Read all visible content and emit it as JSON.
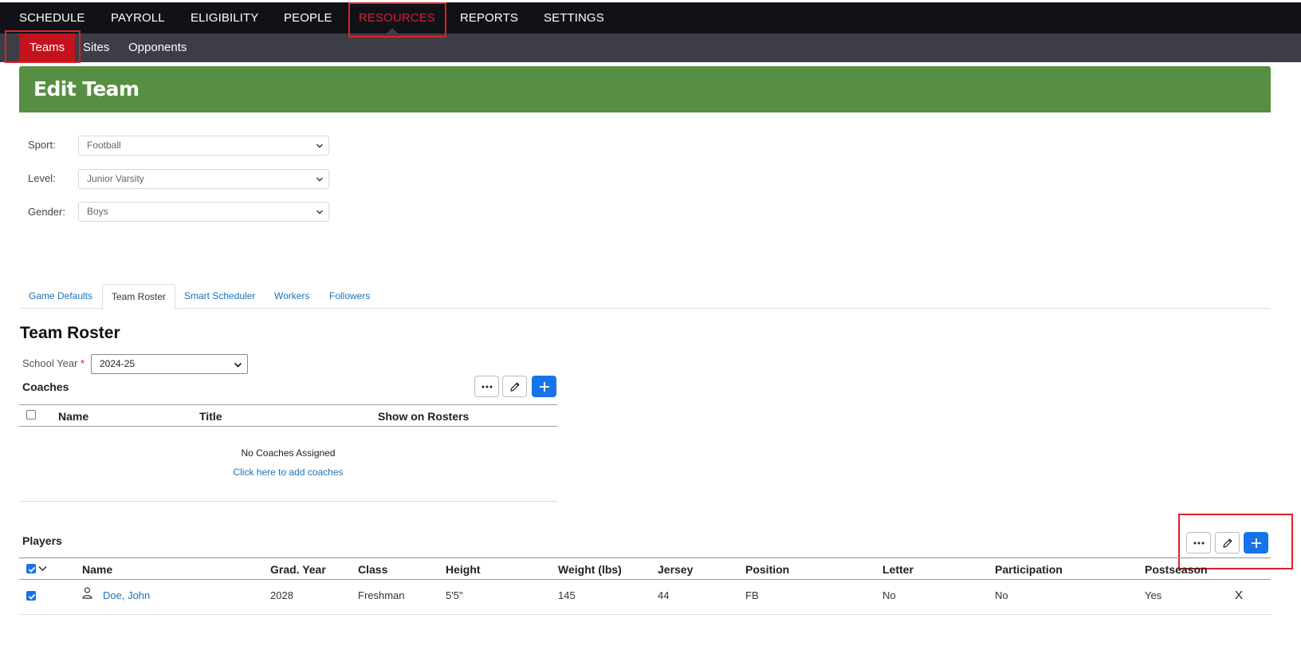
{
  "top_nav": {
    "items": [
      {
        "label": "SCHEDULE"
      },
      {
        "label": "PAYROLL"
      },
      {
        "label": "ELIGIBILITY"
      },
      {
        "label": "PEOPLE"
      },
      {
        "label": "RESOURCES"
      },
      {
        "label": "REPORTS"
      },
      {
        "label": "SETTINGS"
      }
    ],
    "active": "RESOURCES"
  },
  "sub_nav": {
    "items": [
      {
        "label": "Teams"
      },
      {
        "label": "Sites"
      },
      {
        "label": "Opponents"
      }
    ],
    "active": "Teams"
  },
  "page": {
    "title": "Edit Team"
  },
  "form": {
    "sport": {
      "label": "Sport:",
      "value": "Football"
    },
    "level": {
      "label": "Level:",
      "value": "Junior Varsity"
    },
    "gender": {
      "label": "Gender:",
      "value": "Boys"
    }
  },
  "tabs": [
    {
      "label": "Game Defaults"
    },
    {
      "label": "Team Roster"
    },
    {
      "label": "Smart Scheduler"
    },
    {
      "label": "Workers"
    },
    {
      "label": "Followers"
    }
  ],
  "active_tab": "Team Roster",
  "roster": {
    "title": "Team Roster",
    "school_year_label": "School Year",
    "required_mark": "*",
    "school_year_value": "2024-25"
  },
  "coaches": {
    "title": "Coaches",
    "columns": [
      "Name",
      "Title",
      "Show on Rosters"
    ],
    "empty_message": "No Coaches Assigned",
    "add_link": "Click here to add coaches"
  },
  "players": {
    "title": "Players",
    "columns": [
      "Name",
      "Grad. Year",
      "Class",
      "Height",
      "Weight (lbs)",
      "Jersey",
      "Position",
      "Letter",
      "Participation",
      "Postseason"
    ],
    "rows": [
      {
        "name": "Doe, John",
        "grad_year": "2028",
        "class": "Freshman",
        "height": "5'5\"",
        "weight": "145",
        "jersey": "44",
        "position": "FB",
        "letter": "No",
        "participation": "No",
        "postseason": "Yes",
        "remove_label": "X",
        "checked": true
      }
    ]
  },
  "colors": {
    "top_bar": "#111218",
    "sub_bar": "#3c3d47",
    "active_red": "#c4121c",
    "banner_green": "#578f42",
    "primary_blue": "#1873e8",
    "link_blue": "#1d72b8"
  },
  "icons": {
    "more": "more-horizontal-icon",
    "edit": "pencil-icon",
    "add": "plus-icon",
    "person": "person-icon",
    "select": "chevron-down-icon"
  }
}
